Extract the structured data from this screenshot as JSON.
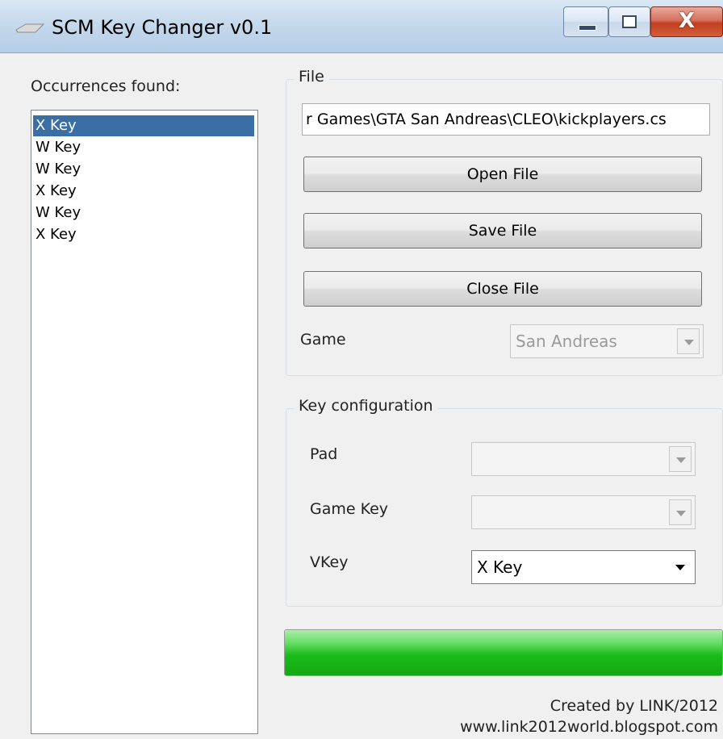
{
  "window": {
    "title": "SCM Key Changer v0.1",
    "icon": "keyboard-key-icon",
    "close_glyph": "X"
  },
  "occurrences": {
    "label": "Occurrences found:",
    "items": [
      {
        "label": "X Key",
        "selected": true
      },
      {
        "label": "W Key",
        "selected": false
      },
      {
        "label": "W Key",
        "selected": false
      },
      {
        "label": "X Key",
        "selected": false
      },
      {
        "label": "W Key",
        "selected": false
      },
      {
        "label": "X Key",
        "selected": false
      }
    ]
  },
  "file_group": {
    "legend": "File",
    "path_value": "r Games\\GTA San Andreas\\CLEO\\kickplayers.cs",
    "open_label": "Open File",
    "save_label": "Save File",
    "close_label": "Close File",
    "game_label": "Game",
    "game_value": "San Andreas"
  },
  "key_group": {
    "legend": "Key configuration",
    "pad_label": "Pad",
    "pad_value": "",
    "gamekey_label": "Game Key",
    "gamekey_value": "",
    "vkey_label": "VKey",
    "vkey_value": "X Key"
  },
  "progress": {
    "value": 1.0,
    "color": "#1cbc1c"
  },
  "credits": {
    "line1": "Created by LINK/2012",
    "line2": "www.link2012world.blogspot.com"
  },
  "colors": {
    "selection": "#3a6ea5",
    "titlebar": "#c6d9ec",
    "close_button": "#c2401f"
  }
}
